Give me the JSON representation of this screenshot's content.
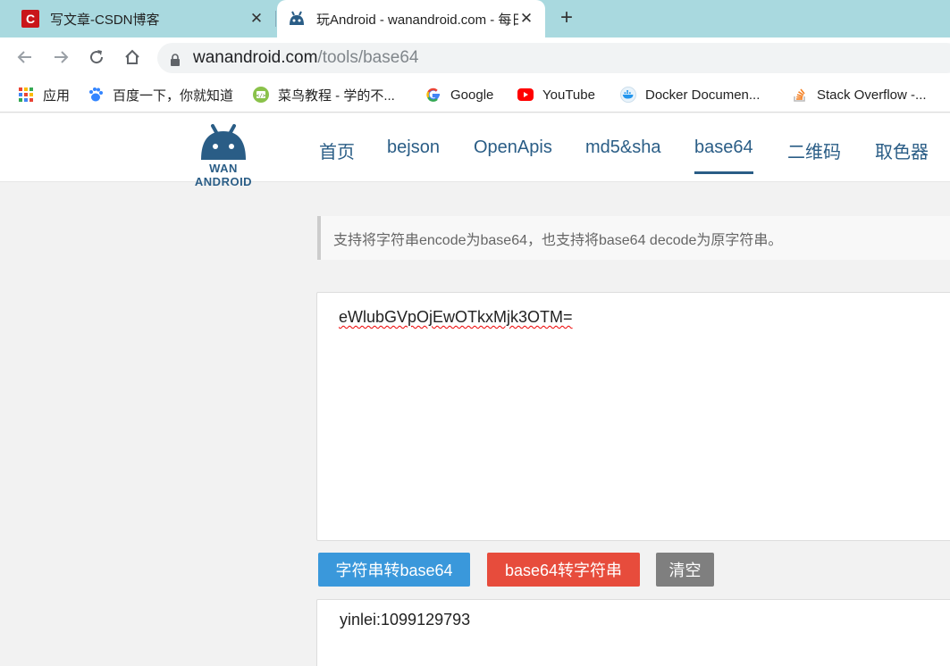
{
  "browser": {
    "tabs": [
      {
        "title": "写文章-CSDN博客",
        "favicon": "csdn-icon",
        "active": false
      },
      {
        "title": "玩Android - wanandroid.com - 每日推荐优质文章",
        "favicon": "android-icon",
        "active": true
      }
    ],
    "new_tab_label": "+",
    "close_label": "✕",
    "address": {
      "host": "wanandroid.com",
      "path": "/tools/base64"
    },
    "bookmarks": [
      {
        "label": "应用",
        "icon": "apps-grid-icon"
      },
      {
        "label": "百度一下，你就知道",
        "icon": "baidu-paw-icon"
      },
      {
        "label": "菜鸟教程 - 学的不...",
        "icon": "runoob-icon"
      },
      {
        "label": "Google",
        "icon": "google-icon"
      },
      {
        "label": "YouTube",
        "icon": "youtube-icon"
      },
      {
        "label": "Docker Documen...",
        "icon": "docker-icon"
      },
      {
        "label": "Stack Overflow -...",
        "icon": "stackoverflow-icon"
      }
    ]
  },
  "site": {
    "logo_text": "WAN ANDROID",
    "nav": [
      {
        "label": "首页"
      },
      {
        "label": "bejson"
      },
      {
        "label": "OpenApis"
      },
      {
        "label": "md5&sha"
      },
      {
        "label": "base64",
        "active": true
      },
      {
        "label": "二维码"
      },
      {
        "label": "取色器"
      }
    ]
  },
  "tool": {
    "description": "支持将字符串encode为base64，也支持将base64 decode为原字符串。",
    "input_value": "eWlubGVpOjEwOTkxMjk3OTM=",
    "buttons": {
      "encode": "字符串转base64",
      "decode": "base64转字符串",
      "clear": "清空"
    },
    "output_value": "yinlei:1099129793"
  },
  "colors": {
    "brand": "#2a5d86",
    "encode_button": "#3a98db",
    "decode_button": "#e74c3c",
    "clear_button": "#7f7f7f",
    "tabstrip": "#a9d9df"
  }
}
